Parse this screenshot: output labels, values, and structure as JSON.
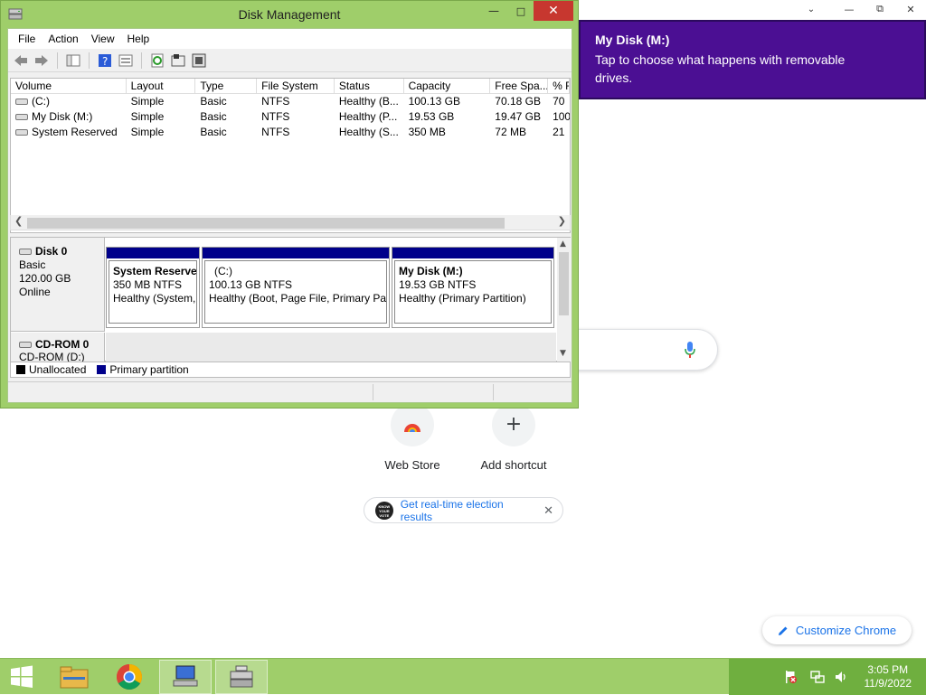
{
  "chrome": {
    "shortcuts": [
      {
        "label": "Web Store",
        "icon": "web-store-icon"
      },
      {
        "label": "Add shortcut",
        "icon": "plus-icon"
      }
    ],
    "election_chip": "Get real-time election results",
    "vote_logo_text": "KNOW YOUR VOTE",
    "customize_label": "Customize Chrome"
  },
  "toast": {
    "title": "My Disk (M:)",
    "body": "Tap to choose what happens with removable drives."
  },
  "window": {
    "title": "Disk Management",
    "menu": [
      "File",
      "Action",
      "View",
      "Help"
    ],
    "columns": [
      "Volume",
      "Layout",
      "Type",
      "File System",
      "Status",
      "Capacity",
      "Free Spa...",
      "% F"
    ],
    "volumes": [
      {
        "volume": "(C:)",
        "layout": "Simple",
        "type": "Basic",
        "fs": "NTFS",
        "status": "Healthy (B...",
        "capacity": "100.13 GB",
        "free": "70.18 GB",
        "pct": "70"
      },
      {
        "volume": "My Disk (M:)",
        "layout": "Simple",
        "type": "Basic",
        "fs": "NTFS",
        "status": "Healthy (P...",
        "capacity": "19.53 GB",
        "free": "19.47 GB",
        "pct": "100"
      },
      {
        "volume": "System Reserved",
        "layout": "Simple",
        "type": "Basic",
        "fs": "NTFS",
        "status": "Healthy (S...",
        "capacity": "350 MB",
        "free": "72 MB",
        "pct": "21"
      }
    ],
    "disk0": {
      "name": "Disk 0",
      "type": "Basic",
      "size": "120.00 GB",
      "state": "Online"
    },
    "partitions": [
      {
        "name": "System Reserve",
        "size": "350 MB NTFS",
        "status": "Healthy (System,"
      },
      {
        "name": "(C:)",
        "size": "100.13 GB NTFS",
        "status": "Healthy (Boot, Page File, Primary Par"
      },
      {
        "name": "My Disk  (M:)",
        "size": "19.53 GB NTFS",
        "status": "Healthy (Primary Partition)"
      }
    ],
    "cdrom": {
      "name": "CD-ROM 0",
      "sub": "CD-ROM (D:)"
    },
    "legend": [
      {
        "label": "Unallocated",
        "color": "#000000"
      },
      {
        "label": "Primary partition",
        "color": "#00008b"
      }
    ]
  },
  "taskbar": {
    "time": "3:05 PM",
    "date": "11/9/2022"
  },
  "colors": {
    "window_frame": "#9fce6a",
    "toast": "#4b0f93",
    "partition_bar": "#00008b",
    "close_button": "#c7372f"
  }
}
